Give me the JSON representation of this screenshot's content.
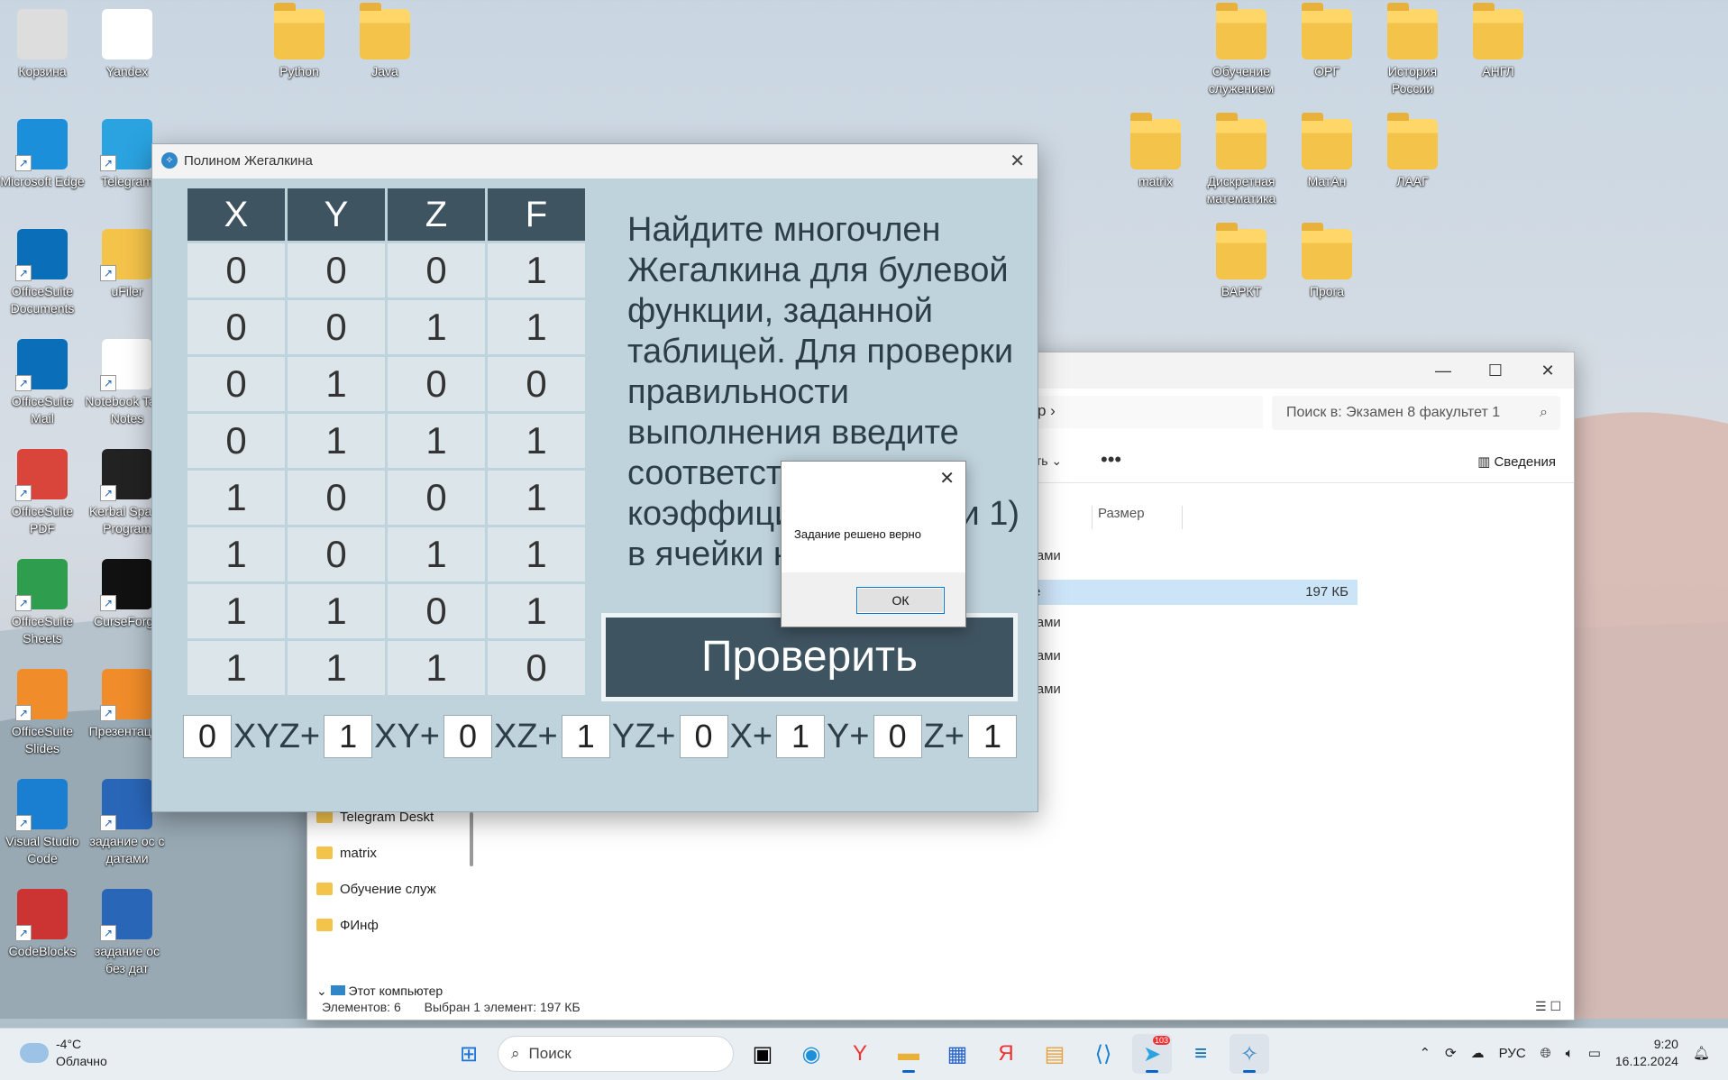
{
  "desktop": {
    "icons_left": [
      {
        "label": "Корзина",
        "name": "recycle-bin"
      },
      {
        "label": "Yandex",
        "name": "yandex"
      },
      {
        "label": "Microsoft Edge",
        "name": "edge"
      },
      {
        "label": "Telegram",
        "name": "telegram"
      },
      {
        "label": "OfficeSuite Documents",
        "name": "officesuite-documents"
      },
      {
        "label": "uFiler",
        "name": "ufiler"
      },
      {
        "label": "OfficeSuite Mail",
        "name": "officesuite-mail"
      },
      {
        "label": "Notebook Take Notes",
        "name": "notebook"
      },
      {
        "label": "OfficeSuite PDF",
        "name": "officesuite-pdf"
      },
      {
        "label": "Kerbal Space Program",
        "name": "kerbal"
      },
      {
        "label": "OfficeSuite Sheets",
        "name": "officesuite-sheets"
      },
      {
        "label": "CurseForge",
        "name": "curseforge"
      },
      {
        "label": "OfficeSuite Slides",
        "name": "officesuite-slides"
      },
      {
        "label": "Презентации",
        "name": "presentations"
      },
      {
        "label": "Visual Studio Code",
        "name": "vscode"
      },
      {
        "label": "задание ос с датами",
        "name": "doc-with-dates"
      },
      {
        "label": "CodeBlocks",
        "name": "codeblocks"
      },
      {
        "label": "задание ос без дат",
        "name": "doc-without-dates"
      }
    ],
    "folders": [
      {
        "label": "Python"
      },
      {
        "label": "Java"
      },
      {
        "label": "Обучение служением"
      },
      {
        "label": "ОРГ"
      },
      {
        "label": "История России"
      },
      {
        "label": "АНГЛ"
      },
      {
        "label": "matrix"
      },
      {
        "label": "Дискретная математика"
      },
      {
        "label": "МатАн"
      },
      {
        "label": "ЛААГ"
      },
      {
        "label": "ВАРКТ"
      },
      {
        "label": "Прога"
      }
    ]
  },
  "explorer": {
    "address_tail": "р   ›",
    "search_placeholder": "Поиск в: Экзамен 8 факультет 1",
    "more": "•••",
    "details": "Сведения",
    "share_fragment": "ить ⌄",
    "column_size": "Размер",
    "rows": [
      "лами",
      "лами",
      "лами",
      "лами",
      "лами"
    ],
    "selected_row": {
      "name": "е",
      "size": "197 КБ"
    },
    "nav": [
      "Telegram Deskt",
      "matrix",
      "Обучение служ",
      "ФИнф"
    ],
    "nav_pc": "Этот компьютер",
    "status_count": "Элементов: 6",
    "status_selected": "Выбран 1 элемент: 197 КБ"
  },
  "app": {
    "title": "Полином Жегалкина",
    "table": {
      "headers": [
        "X",
        "Y",
        "Z",
        "F"
      ],
      "rows": [
        [
          "0",
          "0",
          "0",
          "1"
        ],
        [
          "0",
          "0",
          "1",
          "1"
        ],
        [
          "0",
          "1",
          "0",
          "0"
        ],
        [
          "0",
          "1",
          "1",
          "1"
        ],
        [
          "1",
          "0",
          "0",
          "1"
        ],
        [
          "1",
          "0",
          "1",
          "1"
        ],
        [
          "1",
          "1",
          "0",
          "1"
        ],
        [
          "1",
          "1",
          "1",
          "0"
        ]
      ]
    },
    "task_text": "Найдите многочлен Жегалкина для булевой функции, заданной таблицей. Для проверки правильности выполнения введите соответствующие коэффициенты (0 или 1) в ячейки ниже",
    "check_button": "Проверить",
    "polynomial": {
      "coefficients": [
        "0",
        "1",
        "0",
        "1",
        "0",
        "1",
        "0",
        "1"
      ],
      "terms": [
        "XYZ+",
        "XY+",
        "XZ+",
        "YZ+",
        "X+",
        "Y+",
        "Z+",
        ""
      ]
    }
  },
  "message_box": {
    "text": "Задание решено верно",
    "ok": "ОК"
  },
  "taskbar": {
    "weather_temp": "-4°C",
    "weather_desc": "Облачно",
    "search_placeholder": "Поиск",
    "lang": "РУС",
    "time": "9:20",
    "date": "16.12.2024",
    "telegram_badge": "103"
  },
  "colors": {
    "app_bg": "#bfd3dc",
    "header_bg": "#3f5461",
    "cell_bg": "#dce6ea"
  }
}
